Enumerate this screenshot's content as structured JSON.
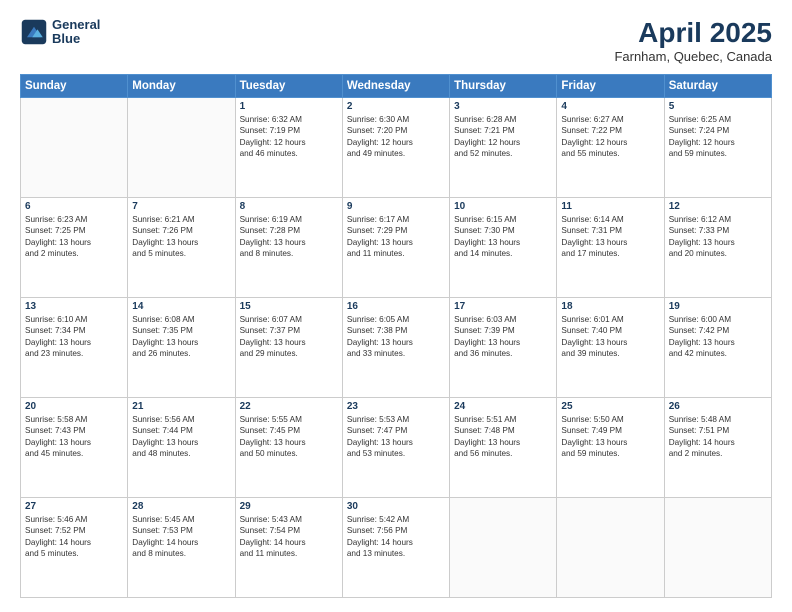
{
  "header": {
    "logo_line1": "General",
    "logo_line2": "Blue",
    "title": "April 2025",
    "subtitle": "Farnham, Quebec, Canada"
  },
  "days_of_week": [
    "Sunday",
    "Monday",
    "Tuesday",
    "Wednesday",
    "Thursday",
    "Friday",
    "Saturday"
  ],
  "weeks": [
    [
      {
        "day": "",
        "info": ""
      },
      {
        "day": "",
        "info": ""
      },
      {
        "day": "1",
        "info": "Sunrise: 6:32 AM\nSunset: 7:19 PM\nDaylight: 12 hours\nand 46 minutes."
      },
      {
        "day": "2",
        "info": "Sunrise: 6:30 AM\nSunset: 7:20 PM\nDaylight: 12 hours\nand 49 minutes."
      },
      {
        "day": "3",
        "info": "Sunrise: 6:28 AM\nSunset: 7:21 PM\nDaylight: 12 hours\nand 52 minutes."
      },
      {
        "day": "4",
        "info": "Sunrise: 6:27 AM\nSunset: 7:22 PM\nDaylight: 12 hours\nand 55 minutes."
      },
      {
        "day": "5",
        "info": "Sunrise: 6:25 AM\nSunset: 7:24 PM\nDaylight: 12 hours\nand 59 minutes."
      }
    ],
    [
      {
        "day": "6",
        "info": "Sunrise: 6:23 AM\nSunset: 7:25 PM\nDaylight: 13 hours\nand 2 minutes."
      },
      {
        "day": "7",
        "info": "Sunrise: 6:21 AM\nSunset: 7:26 PM\nDaylight: 13 hours\nand 5 minutes."
      },
      {
        "day": "8",
        "info": "Sunrise: 6:19 AM\nSunset: 7:28 PM\nDaylight: 13 hours\nand 8 minutes."
      },
      {
        "day": "9",
        "info": "Sunrise: 6:17 AM\nSunset: 7:29 PM\nDaylight: 13 hours\nand 11 minutes."
      },
      {
        "day": "10",
        "info": "Sunrise: 6:15 AM\nSunset: 7:30 PM\nDaylight: 13 hours\nand 14 minutes."
      },
      {
        "day": "11",
        "info": "Sunrise: 6:14 AM\nSunset: 7:31 PM\nDaylight: 13 hours\nand 17 minutes."
      },
      {
        "day": "12",
        "info": "Sunrise: 6:12 AM\nSunset: 7:33 PM\nDaylight: 13 hours\nand 20 minutes."
      }
    ],
    [
      {
        "day": "13",
        "info": "Sunrise: 6:10 AM\nSunset: 7:34 PM\nDaylight: 13 hours\nand 23 minutes."
      },
      {
        "day": "14",
        "info": "Sunrise: 6:08 AM\nSunset: 7:35 PM\nDaylight: 13 hours\nand 26 minutes."
      },
      {
        "day": "15",
        "info": "Sunrise: 6:07 AM\nSunset: 7:37 PM\nDaylight: 13 hours\nand 29 minutes."
      },
      {
        "day": "16",
        "info": "Sunrise: 6:05 AM\nSunset: 7:38 PM\nDaylight: 13 hours\nand 33 minutes."
      },
      {
        "day": "17",
        "info": "Sunrise: 6:03 AM\nSunset: 7:39 PM\nDaylight: 13 hours\nand 36 minutes."
      },
      {
        "day": "18",
        "info": "Sunrise: 6:01 AM\nSunset: 7:40 PM\nDaylight: 13 hours\nand 39 minutes."
      },
      {
        "day": "19",
        "info": "Sunrise: 6:00 AM\nSunset: 7:42 PM\nDaylight: 13 hours\nand 42 minutes."
      }
    ],
    [
      {
        "day": "20",
        "info": "Sunrise: 5:58 AM\nSunset: 7:43 PM\nDaylight: 13 hours\nand 45 minutes."
      },
      {
        "day": "21",
        "info": "Sunrise: 5:56 AM\nSunset: 7:44 PM\nDaylight: 13 hours\nand 48 minutes."
      },
      {
        "day": "22",
        "info": "Sunrise: 5:55 AM\nSunset: 7:45 PM\nDaylight: 13 hours\nand 50 minutes."
      },
      {
        "day": "23",
        "info": "Sunrise: 5:53 AM\nSunset: 7:47 PM\nDaylight: 13 hours\nand 53 minutes."
      },
      {
        "day": "24",
        "info": "Sunrise: 5:51 AM\nSunset: 7:48 PM\nDaylight: 13 hours\nand 56 minutes."
      },
      {
        "day": "25",
        "info": "Sunrise: 5:50 AM\nSunset: 7:49 PM\nDaylight: 13 hours\nand 59 minutes."
      },
      {
        "day": "26",
        "info": "Sunrise: 5:48 AM\nSunset: 7:51 PM\nDaylight: 14 hours\nand 2 minutes."
      }
    ],
    [
      {
        "day": "27",
        "info": "Sunrise: 5:46 AM\nSunset: 7:52 PM\nDaylight: 14 hours\nand 5 minutes."
      },
      {
        "day": "28",
        "info": "Sunrise: 5:45 AM\nSunset: 7:53 PM\nDaylight: 14 hours\nand 8 minutes."
      },
      {
        "day": "29",
        "info": "Sunrise: 5:43 AM\nSunset: 7:54 PM\nDaylight: 14 hours\nand 11 minutes."
      },
      {
        "day": "30",
        "info": "Sunrise: 5:42 AM\nSunset: 7:56 PM\nDaylight: 14 hours\nand 13 minutes."
      },
      {
        "day": "",
        "info": ""
      },
      {
        "day": "",
        "info": ""
      },
      {
        "day": "",
        "info": ""
      }
    ]
  ]
}
